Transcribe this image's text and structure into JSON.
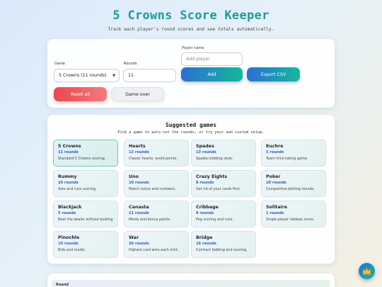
{
  "header": {
    "title": "5 Crowns Score Keeper",
    "subtitle": "Track each player's round scores and see totals automatically."
  },
  "controls": {
    "game_label": "Game",
    "game_value": "5 Crowns (11 rounds)",
    "rounds_label": "Rounds",
    "rounds_value": "11",
    "player_name_label": "Player name",
    "player_placeholder": "Add player",
    "add_label": "Add",
    "export_label": "Export CSV",
    "reset_label": "Reset all",
    "game_over_label": "Game over"
  },
  "suggested": {
    "title": "Suggested games",
    "subtitle": "Pick a game to auto-set the rounds, or try your own custom setup.",
    "games": [
      {
        "name": "5 Crowns",
        "rounds": "11 rounds",
        "desc": "Standard 5 Crowns scoring."
      },
      {
        "name": "Hearts",
        "rounds": "13 rounds",
        "desc": "Classic hearts: avoid points."
      },
      {
        "name": "Spades",
        "rounds": "13 rounds",
        "desc": "Spades bidding style."
      },
      {
        "name": "Euchre",
        "rounds": "5 rounds",
        "desc": "Team trick-taking game."
      },
      {
        "name": "Rummy",
        "rounds": "10 rounds",
        "desc": "Sets and runs scoring."
      },
      {
        "name": "Uno",
        "rounds": "10 rounds",
        "desc": "Match colors and numbers."
      },
      {
        "name": "Crazy Eights",
        "rounds": "8 rounds",
        "desc": "Get rid of your cards first."
      },
      {
        "name": "Poker",
        "rounds": "10 rounds",
        "desc": "Competitive betting rounds."
      },
      {
        "name": "Blackjack",
        "rounds": "5 rounds",
        "desc": "Beat the dealer without busting."
      },
      {
        "name": "Canasta",
        "rounds": "11 rounds",
        "desc": "Melds and bonus points."
      },
      {
        "name": "Cribbage",
        "rounds": "8 rounds",
        "desc": "Peg scoring and runs."
      },
      {
        "name": "Solitaire",
        "rounds": "1 rounds",
        "desc": "Single-player tableau score."
      },
      {
        "name": "Pinochle",
        "rounds": "10 rounds",
        "desc": "Bids and melds."
      },
      {
        "name": "War",
        "rounds": "26 rounds",
        "desc": "Highest card wins each trick."
      },
      {
        "name": "Bridge",
        "rounds": "16 rounds",
        "desc": "Contract bidding and scoring."
      }
    ]
  },
  "scoreboard": {
    "round_header": "Round"
  },
  "fab": {
    "icon": "crown-icon"
  }
}
